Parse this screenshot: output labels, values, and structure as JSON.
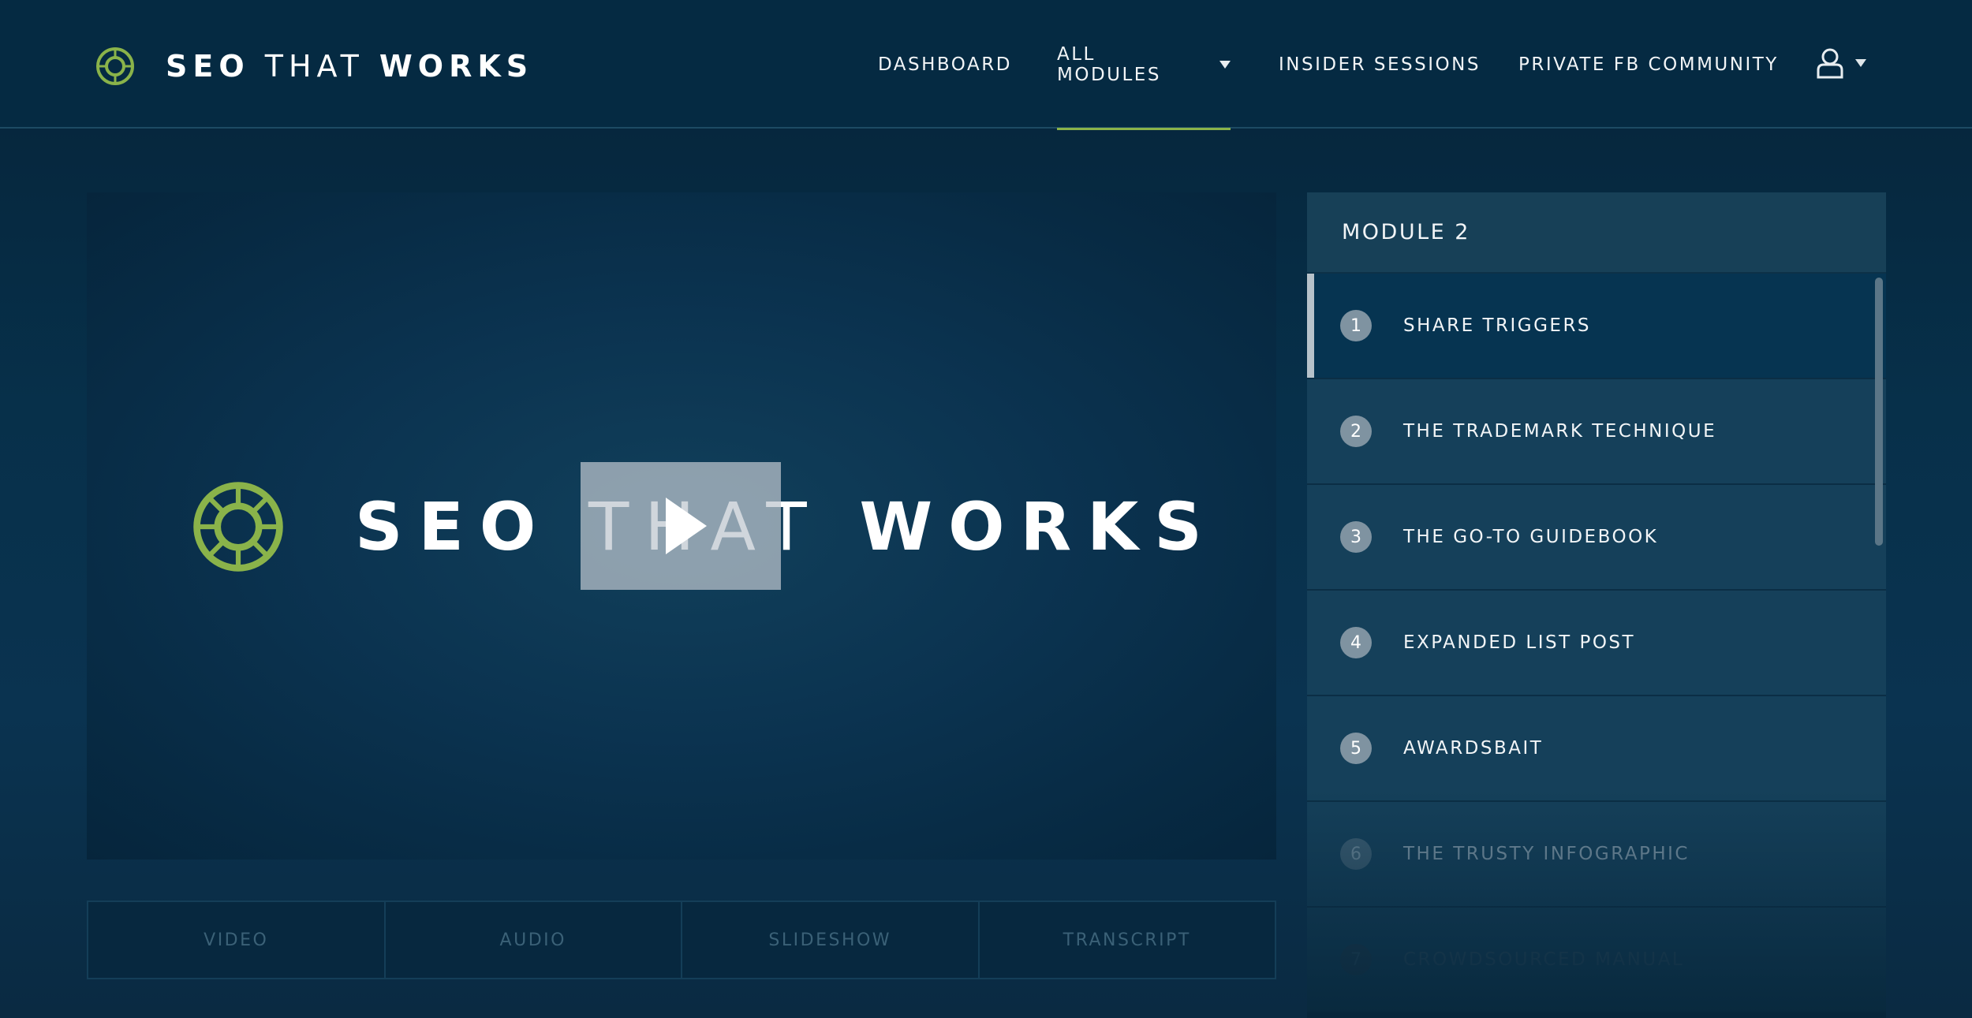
{
  "header": {
    "logo_bold": "SEO",
    "logo_light": "THAT",
    "logo_bold2": "WORKS",
    "nav": [
      {
        "label": "DASHBOARD"
      },
      {
        "label": "ALL MODULES",
        "active": true,
        "has_caret": true
      },
      {
        "label": "INSIDER SESSIONS"
      },
      {
        "label": "PRIVATE FB COMMUNITY"
      }
    ],
    "user_icon": "user-icon"
  },
  "video": {
    "title_bold": "SEO",
    "title_light": "THAT",
    "title_bold2": "WORKS",
    "play_icon": "play-icon"
  },
  "tabs": [
    "VIDEO",
    "AUDIO",
    "SLIDESHOW",
    "TRANSCRIPT"
  ],
  "sidebar": {
    "heading": "MODULE 2",
    "lessons": [
      {
        "num": "1",
        "title": "SHARE TRIGGERS",
        "active": true
      },
      {
        "num": "2",
        "title": "THE TRADEMARK TECHNIQUE"
      },
      {
        "num": "3",
        "title": "THE GO-TO GUIDEBOOK"
      },
      {
        "num": "4",
        "title": "EXPANDED LIST POST"
      },
      {
        "num": "5",
        "title": "AWARDSBAIT"
      },
      {
        "num": "6",
        "title": "THE TRUSTY INFOGRAPHIC"
      },
      {
        "num": "7",
        "title": "CROWDSOURCED MANUAL"
      }
    ]
  },
  "colors": {
    "accent": "#8ab34a",
    "background": "#062a40",
    "sidebar_item": "#15405a",
    "sidebar_active": "#063451"
  }
}
